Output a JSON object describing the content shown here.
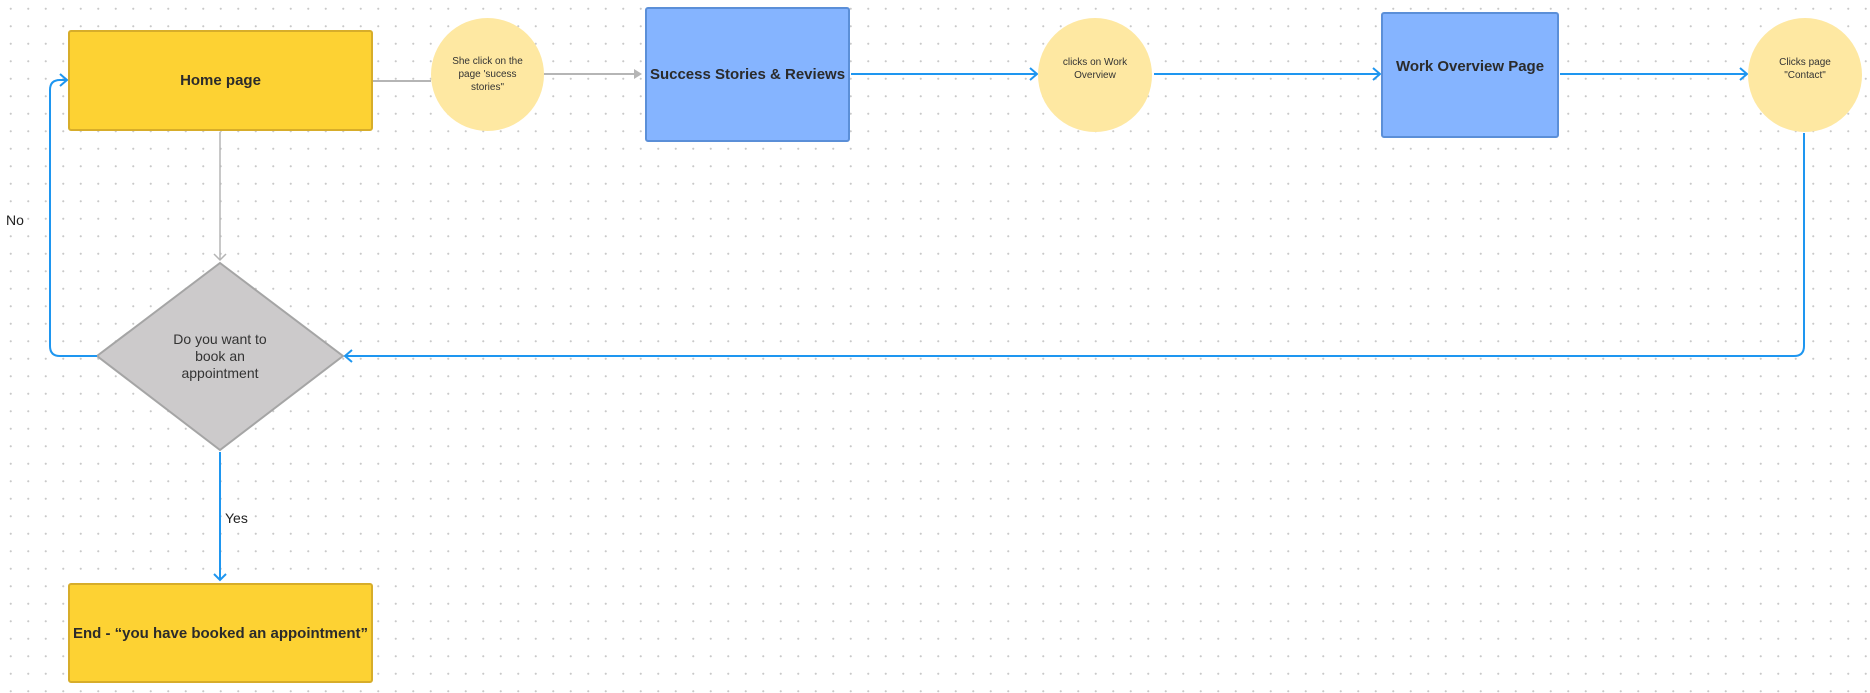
{
  "diagram": {
    "nodes": {
      "home": {
        "label": "Home page",
        "shape": "rectangle",
        "color": "#fdd233"
      },
      "step1": {
        "label": "She click on the page 'sucess stories\"",
        "lines": [
          "She click on the",
          "page 'sucess",
          "stories\""
        ],
        "shape": "circle",
        "color": "#fee8a2"
      },
      "success": {
        "label": "Success Stories & Reviews",
        "shape": "rectangle",
        "color": "#85b4ff"
      },
      "step2": {
        "label": "clicks on Work Overview",
        "lines": [
          "clicks on Work",
          "Overview"
        ],
        "shape": "circle",
        "color": "#fee8a2"
      },
      "work": {
        "label": "Work Overview Page",
        "shape": "rectangle",
        "color": "#85b4ff"
      },
      "step3": {
        "label": "Clicks page \"Contact\"",
        "lines": [
          "Clicks page",
          "\"Contact\""
        ],
        "shape": "circle",
        "color": "#fee8a2"
      },
      "decision": {
        "label": "Do you want to book an appointment",
        "lines": [
          "Do you want to",
          "book an",
          "appointment"
        ],
        "shape": "diamond",
        "color": "#cccacb"
      },
      "end": {
        "label": "End - “you have booked an appointment”",
        "shape": "rectangle",
        "color": "#fdd233"
      }
    },
    "edges": [
      {
        "from": "home",
        "to": "step1",
        "color": "#b5b5b5",
        "arrow": false
      },
      {
        "from": "step1",
        "to": "success",
        "color": "#b5b5b5",
        "arrow": true
      },
      {
        "from": "success",
        "to": "step2",
        "color": "#1e96f0",
        "arrow": true
      },
      {
        "from": "step2",
        "to": "work",
        "color": "#1e96f0",
        "arrow": true
      },
      {
        "from": "work",
        "to": "step3",
        "color": "#1e96f0",
        "arrow": true
      },
      {
        "from": "step3",
        "to": "decision",
        "color": "#1e96f0",
        "arrow": true
      },
      {
        "from": "home",
        "to": "decision",
        "color": "#b5b5b5",
        "arrow": true
      },
      {
        "from": "decision",
        "to": "home",
        "label": "No",
        "color": "#1e96f0",
        "arrow": true
      },
      {
        "from": "decision",
        "to": "end",
        "label": "Yes",
        "color": "#1e96f0",
        "arrow": true
      }
    ],
    "edge_labels": {
      "no": "No",
      "yes": "Yes"
    }
  }
}
